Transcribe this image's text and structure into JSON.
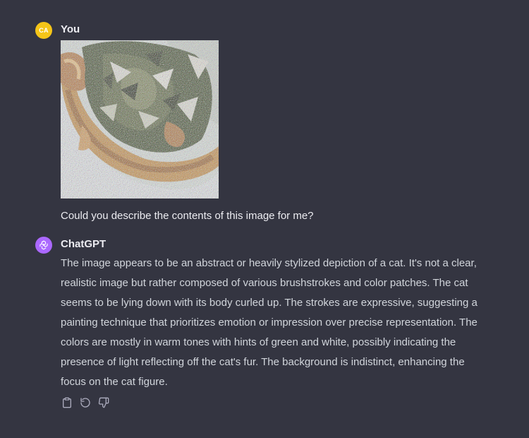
{
  "user_message": {
    "avatar_initials": "CA",
    "author": "You",
    "image_alt": "abstract stylized cat painting",
    "text": "Could you describe the contents of this image for me?"
  },
  "assistant_message": {
    "avatar_icon": "openai-logo-icon",
    "author": "ChatGPT",
    "text": "The image appears to be an abstract or heavily stylized depiction of a cat. It's not a clear, realistic image but rather composed of various brushstrokes and color patches. The cat seems to be lying down with its body curled up. The strokes are expressive, suggesting a painting technique that prioritizes emotion or impression over precise representation. The colors are mostly in warm tones with hints of green and white, possibly indicating the presence of light reflecting off the cat's fur. The background is indistinct, enhancing the focus on the cat figure."
  },
  "actions": [
    {
      "name": "copy-icon"
    },
    {
      "name": "regenerate-icon"
    },
    {
      "name": "thumbs-down-icon"
    }
  ],
  "colors": {
    "background": "#343541",
    "user_avatar": "#f5c518",
    "bot_avatar": "#ab68ff",
    "text_primary": "#ececf1",
    "text_secondary": "#d1d5db",
    "icon": "#acacbe"
  }
}
